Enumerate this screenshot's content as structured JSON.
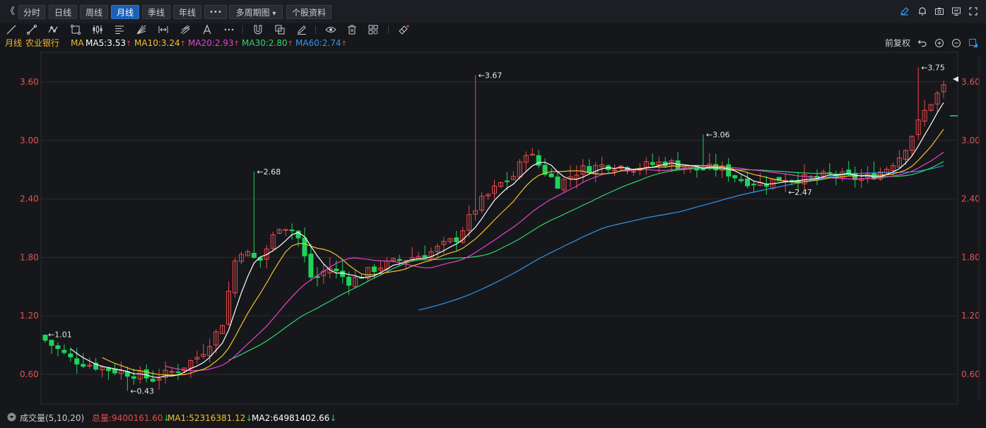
{
  "toolbar": {
    "collapse_glyph": "《",
    "periods": [
      "分时",
      "日线",
      "周线",
      "月线",
      "季线",
      "年线"
    ],
    "active_period": "月线",
    "more_label": "•••",
    "multi_period_label": "多周期图",
    "multi_period_caret": "▾",
    "stock_info_label": "个股资料"
  },
  "drawing_tools": [
    "line-tool",
    "ray-tool",
    "polyline-tool",
    "rect-tool",
    "parallel-tool",
    "fib-tool",
    "gann-tool",
    "measure-tool",
    "pitchfork-tool",
    "text-tool",
    "more-tools",
    "magnet-tool",
    "clone-tool",
    "pen-tool",
    "eye-tool",
    "trash-tool",
    "layout-tool",
    "eraser-tool"
  ],
  "indicator_row": {
    "period_name": "月线",
    "stock_name": "农业银行",
    "ma_label": "MA",
    "ma5": "MA5:3.53",
    "ma10": "MA10:3.24",
    "ma20": "MA20:2.93",
    "ma30": "MA30:2.80",
    "ma60": "MA60:2.74",
    "adjust_label": "前复权",
    "colors": {
      "ma5": "#ffffff",
      "ma10": "#f2c230",
      "ma20": "#e444c8",
      "ma30": "#2fd46a",
      "ma60": "#2e97f0"
    }
  },
  "chart_data": {
    "type": "candlestick",
    "y_ticks": [
      "3.60",
      "3.00",
      "2.40",
      "1.80",
      "1.20",
      "0.60"
    ],
    "y_tick_values": [
      3.6,
      3.0,
      2.4,
      1.8,
      1.2,
      0.6
    ],
    "ylim": [
      0.35,
      3.95
    ],
    "annotations": [
      {
        "label": "1.01",
        "value": 1.01
      },
      {
        "label": "0.43",
        "value": 0.43
      },
      {
        "label": "2.68",
        "value": 2.68
      },
      {
        "label": "3.67",
        "value": 3.67
      },
      {
        "label": "3.06",
        "value": 3.06
      },
      {
        "label": "2.47",
        "value": 2.47
      },
      {
        "label": "3.75",
        "value": 3.75
      }
    ],
    "colors": {
      "up": "#e94a4a",
      "down": "#1fd35a",
      "grid": "#2a2c33",
      "axis_text": "#e05555"
    }
  },
  "volume_bar": {
    "label": "成交量(5,10,20)",
    "total": "总量:9400161.60",
    "ma1": "MA1:52316381.12",
    "ma2": "MA2:64981402.66",
    "down_arrow": "↓"
  }
}
